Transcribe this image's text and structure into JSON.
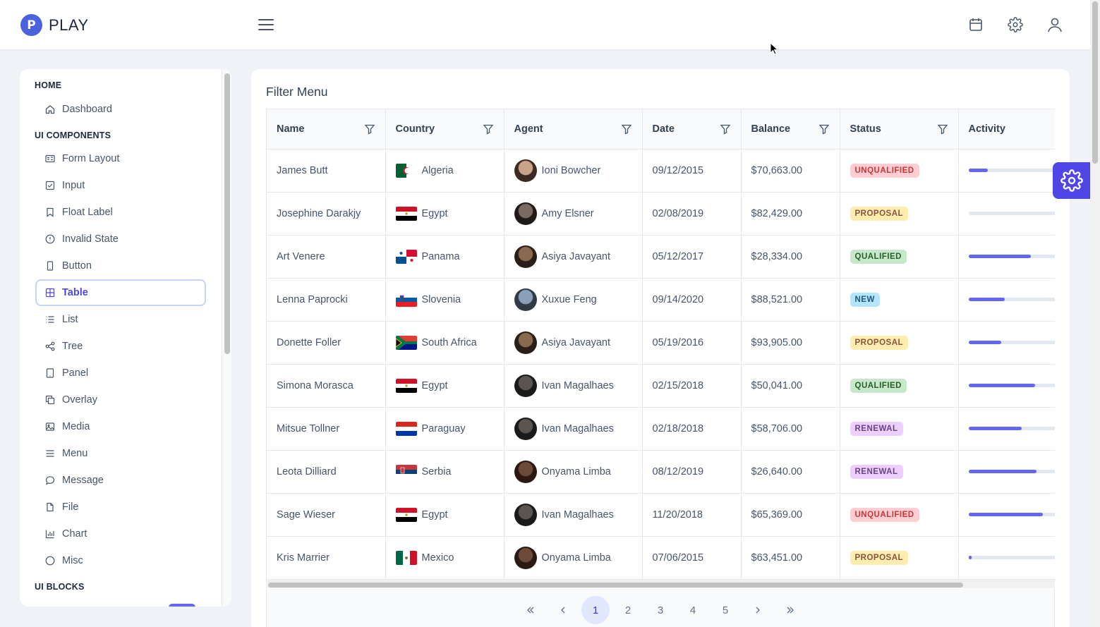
{
  "app": {
    "logo_letter": "P",
    "name": "PLAY"
  },
  "topbar": {
    "icons": [
      "calendar-icon",
      "gear-icon",
      "user-icon"
    ]
  },
  "sidebar": {
    "sections": [
      {
        "title": "HOME",
        "items": [
          {
            "label": "Dashboard",
            "icon": "home-icon"
          }
        ]
      },
      {
        "title": "UI COMPONENTS",
        "items": [
          {
            "label": "Form Layout",
            "icon": "id-card-icon"
          },
          {
            "label": "Input",
            "icon": "check-square-icon"
          },
          {
            "label": "Float Label",
            "icon": "bookmark-icon"
          },
          {
            "label": "Invalid State",
            "icon": "exclamation-circle-icon"
          },
          {
            "label": "Button",
            "icon": "mobile-icon"
          },
          {
            "label": "Table",
            "icon": "table-icon",
            "active": true
          },
          {
            "label": "List",
            "icon": "list-icon"
          },
          {
            "label": "Tree",
            "icon": "share-alt-icon"
          },
          {
            "label": "Panel",
            "icon": "tablet-icon"
          },
          {
            "label": "Overlay",
            "icon": "clone-icon"
          },
          {
            "label": "Media",
            "icon": "image-icon"
          },
          {
            "label": "Menu",
            "icon": "bars-icon"
          },
          {
            "label": "Message",
            "icon": "comment-icon"
          },
          {
            "label": "File",
            "icon": "file-icon"
          },
          {
            "label": "Chart",
            "icon": "chart-bar-icon"
          },
          {
            "label": "Misc",
            "icon": "circle-icon"
          }
        ]
      },
      {
        "title": "UI BLOCKS",
        "items": []
      }
    ]
  },
  "card": {
    "title": "Filter Menu"
  },
  "table": {
    "columns": [
      "Name",
      "Country",
      "Agent",
      "Date",
      "Balance",
      "Status",
      "Activity"
    ],
    "rows": [
      {
        "name": "James Butt",
        "country": "Algeria",
        "agent": "Ioni Bowcher",
        "date": "09/12/2015",
        "balance": "$70,663.00",
        "status": "UNQUALIFIED",
        "activity": 0.17
      },
      {
        "name": "Josephine Darakjy",
        "country": "Egypt",
        "agent": "Amy Elsner",
        "date": "02/08/2019",
        "balance": "$82,429.00",
        "status": "PROPOSAL",
        "activity": 0.0
      },
      {
        "name": "Art Venere",
        "country": "Panama",
        "agent": "Asiya Javayant",
        "date": "05/12/2017",
        "balance": "$28,334.00",
        "status": "QUALIFIED",
        "activity": 0.55
      },
      {
        "name": "Lenna Paprocki",
        "country": "Slovenia",
        "agent": "Xuxue Feng",
        "date": "09/14/2020",
        "balance": "$88,521.00",
        "status": "NEW",
        "activity": 0.32
      },
      {
        "name": "Donette Foller",
        "country": "South Africa",
        "agent": "Asiya Javayant",
        "date": "05/19/2016",
        "balance": "$93,905.00",
        "status": "PROPOSAL",
        "activity": 0.29
      },
      {
        "name": "Simona Morasca",
        "country": "Egypt",
        "agent": "Ivan Magalhaes",
        "date": "02/15/2018",
        "balance": "$50,041.00",
        "status": "QUALIFIED",
        "activity": 0.59
      },
      {
        "name": "Mitsue Tollner",
        "country": "Paraguay",
        "agent": "Ivan Magalhaes",
        "date": "02/18/2018",
        "balance": "$58,706.00",
        "status": "RENEWAL",
        "activity": 0.47
      },
      {
        "name": "Leota Dilliard",
        "country": "Serbia",
        "agent": "Onyama Limba",
        "date": "08/12/2019",
        "balance": "$26,640.00",
        "status": "RENEWAL",
        "activity": 0.6
      },
      {
        "name": "Sage Wieser",
        "country": "Egypt",
        "agent": "Ivan Magalhaes",
        "date": "11/20/2018",
        "balance": "$65,369.00",
        "status": "UNQUALIFIED",
        "activity": 0.66
      },
      {
        "name": "Kris Marrier",
        "country": "Mexico",
        "agent": "Onyama Limba",
        "date": "07/06/2015",
        "balance": "$63,451.00",
        "status": "PROPOSAL",
        "activity": 0.03
      }
    ]
  },
  "pagination": {
    "pages": [
      "1",
      "2",
      "3",
      "4",
      "5"
    ],
    "current": "1"
  },
  "colors": {
    "accent": "#6366f1",
    "brand": "#4b61dd"
  }
}
